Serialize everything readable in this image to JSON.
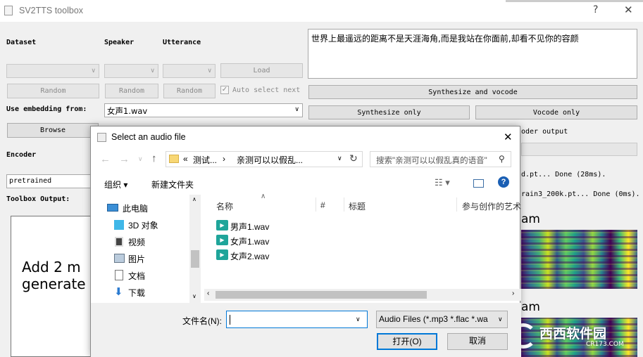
{
  "main_window": {
    "title": "SV2TTS toolbox",
    "help_glyph": "?",
    "close_glyph": "✕",
    "dataset_label": "Dataset",
    "speaker_label": "Speaker",
    "utterance_label": "Utterance",
    "load_button": "Load",
    "random_button": "Random",
    "auto_select_label": "Auto select next",
    "auto_select_checked": true,
    "use_embedding_label": "Use embedding from:",
    "embedding_value": "女声1.wav",
    "browse_button": "Browse",
    "encoder_label": "Encoder",
    "encoder_value": "pretrained",
    "toolbox_output_label": "Toolbox Output:",
    "output_text": "Add 2 m\ngenerate",
    "input_text": "世界上最遥远的距离不是天涯海角,而是我站在你面前,却看不见你的容颜",
    "synthesize_vocode_button": "Synthesize and vocode",
    "synthesize_only_button": "Synthesize only",
    "vocode_only_button": "Vocode only",
    "vocoder_output_partial": "oder output",
    "log_line_1": "d.pt... Done (28ms).",
    "log_line_2": "rain3_200k.pt... Done (0ms).",
    "spectrogram_label_1": "am",
    "spectrogram_label_2": "am",
    "watermark_text": "西西软件园",
    "watermark_sub": "CR173.COM",
    "spectrogram_colors": [
      "#440154",
      "#31688e",
      "#35b779",
      "#fde725"
    ]
  },
  "dialog": {
    "title": "Select an audio file",
    "close_glyph": "✕",
    "path_prefix": "«",
    "path_segment_1": "测试...",
    "path_segment_2": "亲测可以以假乱...",
    "search_placeholder": "搜索\"亲测可以以假乱真的语音\"",
    "organize_label": "组织 ▾",
    "new_folder_label": "新建文件夹",
    "help_glyph": "?",
    "nav_items": [
      {
        "label": "此电脑",
        "icon": "computer-icon"
      },
      {
        "label": "3D 对象",
        "icon": "cube-icon"
      },
      {
        "label": "视频",
        "icon": "video-icon"
      },
      {
        "label": "图片",
        "icon": "picture-icon"
      },
      {
        "label": "文档",
        "icon": "document-icon"
      },
      {
        "label": "下载",
        "icon": "download-icon"
      }
    ],
    "columns": [
      "名称",
      "#",
      "标题",
      "参与创作的艺术"
    ],
    "files": [
      "男声1.wav",
      "女声1.wav",
      "女声2.wav"
    ],
    "filename_label": "文件名(N):",
    "filename_value": "",
    "filter_value": "Audio Files (*.mp3 *.flac *.wa",
    "open_button": "打开(O)",
    "cancel_button": "取消"
  }
}
